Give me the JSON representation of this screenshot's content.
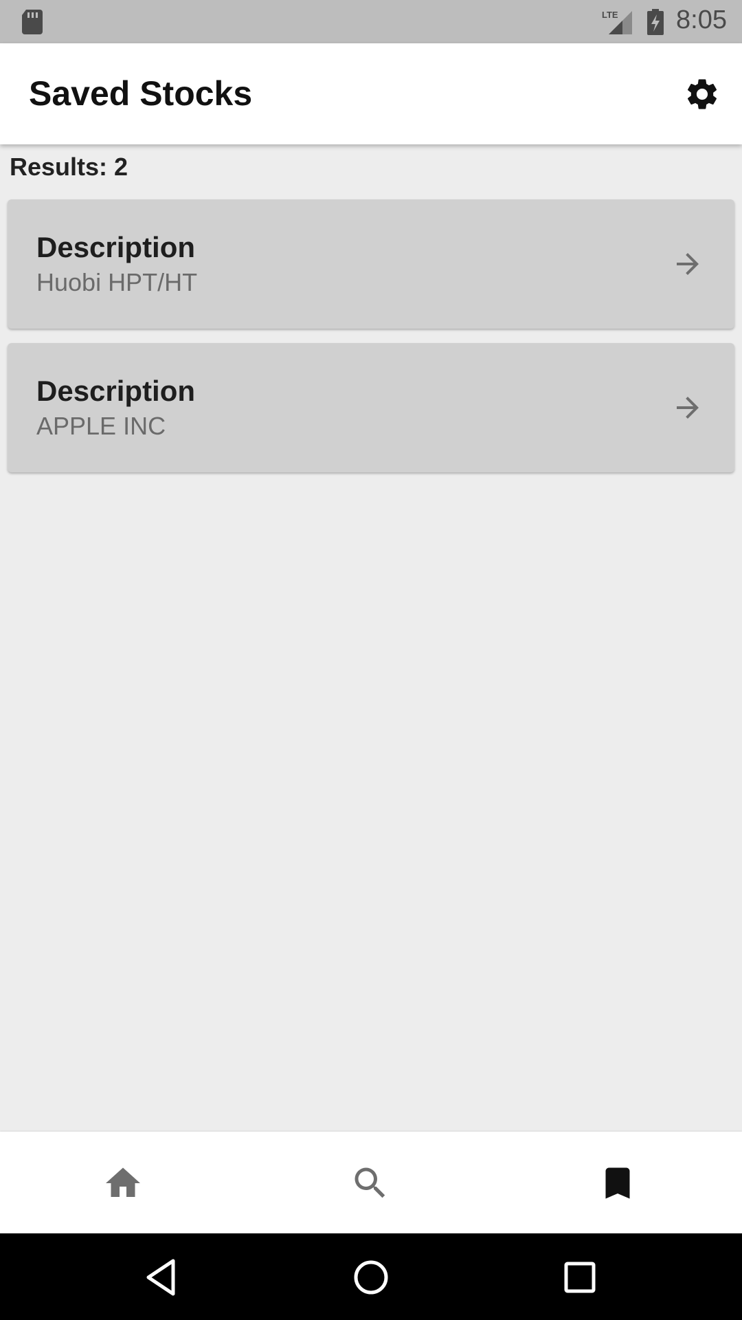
{
  "status_bar": {
    "time": "8:05",
    "network_label": "LTE",
    "icons": [
      "sd-card-icon",
      "lte-signal-icon",
      "battery-charging-icon"
    ]
  },
  "app_bar": {
    "title": "Saved Stocks",
    "settings_icon": "gear-icon"
  },
  "results": {
    "label": "Results: 2"
  },
  "stocks": [
    {
      "title": "Description",
      "name": "Huobi HPT/HT",
      "icon": "arrow-right-icon"
    },
    {
      "title": "Description",
      "name": "APPLE INC",
      "icon": "arrow-right-icon"
    }
  ],
  "bottom_nav": {
    "items": [
      {
        "id": "home",
        "icon": "home-icon",
        "active": false
      },
      {
        "id": "search",
        "icon": "search-icon",
        "active": false
      },
      {
        "id": "saved",
        "icon": "bookmark-icon",
        "active": true
      }
    ]
  },
  "system_nav": {
    "buttons": [
      "back-icon",
      "home-circle-icon",
      "recents-icon"
    ]
  },
  "colors": {
    "background": "#ededed",
    "card": "#d0d0d0",
    "status_bar": "#bdbdbd",
    "active_icon": "#111111",
    "inactive_icon": "#6e6e6e"
  }
}
